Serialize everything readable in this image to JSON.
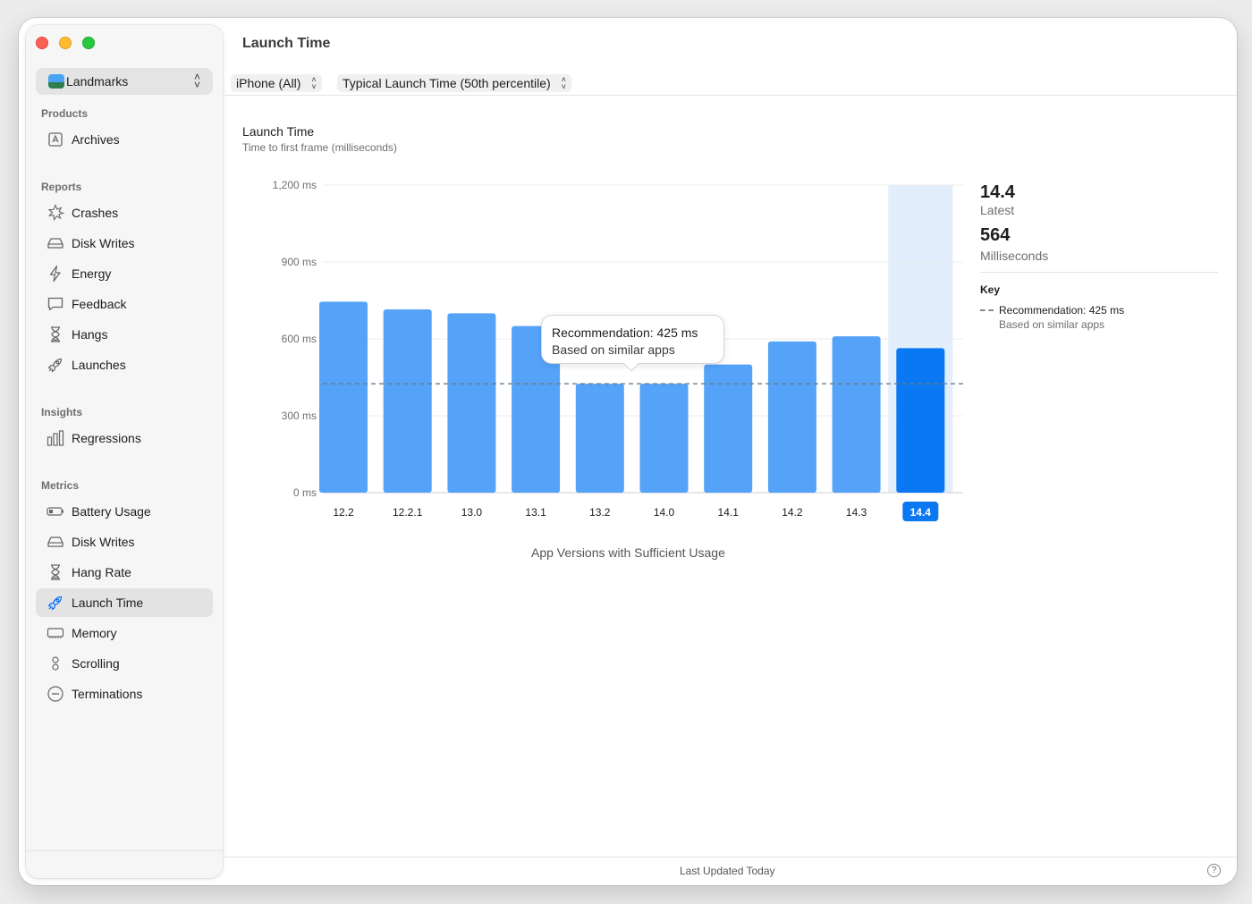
{
  "app": {
    "picker_label": "Landmarks",
    "picker_icon": "app-landmarks-icon",
    "page_title": "Launch Time"
  },
  "sidebar": {
    "sections": [
      {
        "title": "Products",
        "items": [
          {
            "label": "Archives",
            "icon": "archive-box-icon"
          }
        ]
      },
      {
        "title": "Reports",
        "items": [
          {
            "label": "Crashes",
            "icon": "crash-burst-icon"
          },
          {
            "label": "Disk Writes",
            "icon": "disk-drive-icon"
          },
          {
            "label": "Energy",
            "icon": "energy-bolt-icon"
          },
          {
            "label": "Feedback",
            "icon": "feedback-bubble-icon"
          },
          {
            "label": "Hangs",
            "icon": "hourglass-icon"
          },
          {
            "label": "Launches",
            "icon": "rocket-icon"
          }
        ]
      },
      {
        "title": "Insights",
        "items": [
          {
            "label": "Regressions",
            "icon": "bar-trend-icon"
          }
        ]
      },
      {
        "title": "Metrics",
        "items": [
          {
            "label": "Battery Usage",
            "icon": "battery-icon"
          },
          {
            "label": "Disk Writes",
            "icon": "disk-drive-icon"
          },
          {
            "label": "Hang Rate",
            "icon": "hourglass-icon"
          },
          {
            "label": "Launch Time",
            "icon": "rocket-icon",
            "selected": true
          },
          {
            "label": "Memory",
            "icon": "memory-chip-icon"
          },
          {
            "label": "Scrolling",
            "icon": "scroll-icon"
          },
          {
            "label": "Terminations",
            "icon": "minus-circle-icon"
          }
        ]
      }
    ]
  },
  "filters": {
    "device": "iPhone (All)",
    "metric": "Typical Launch Time (50th percentile)"
  },
  "chart_header": {
    "title": "Launch Time",
    "subtitle": "Time to first frame (milliseconds)"
  },
  "tooltip": {
    "line1": "Recommendation: 425 ms",
    "line2": "Based on similar apps"
  },
  "summary": {
    "latest_value": "14.4",
    "latest_label": "Latest",
    "ms_value": "564",
    "ms_label": "Milliseconds"
  },
  "key": {
    "title": "Key",
    "line1": "Recommendation: 425 ms",
    "line2": "Based on similar apps"
  },
  "footer": {
    "status": "Last Updated Today",
    "help_icon": "question-circle-icon"
  },
  "colors": {
    "bar": "#55a3f9",
    "bar_selected": "#0a78f2",
    "highlight_column": "#e2eefc",
    "recommendation_line": "#6b7b8c"
  },
  "chart_data": {
    "type": "bar",
    "categories": [
      "12.2",
      "12.2.1",
      "13.0",
      "13.1",
      "13.2",
      "14.0",
      "14.1",
      "14.2",
      "14.3",
      "14.4"
    ],
    "values": [
      745,
      715,
      700,
      650,
      425,
      425,
      500,
      590,
      610,
      564
    ],
    "selected_category": "14.4",
    "yticks": [
      "1,200 ms",
      "900 ms",
      "600 ms",
      "300 ms",
      "0 ms"
    ],
    "ytick_values": [
      1200,
      900,
      600,
      300,
      0
    ],
    "ylim": [
      0,
      1200
    ],
    "recommendation": 425,
    "xlabel": "App Versions with Sufficient Usage",
    "ylabel": "",
    "grid": true
  }
}
